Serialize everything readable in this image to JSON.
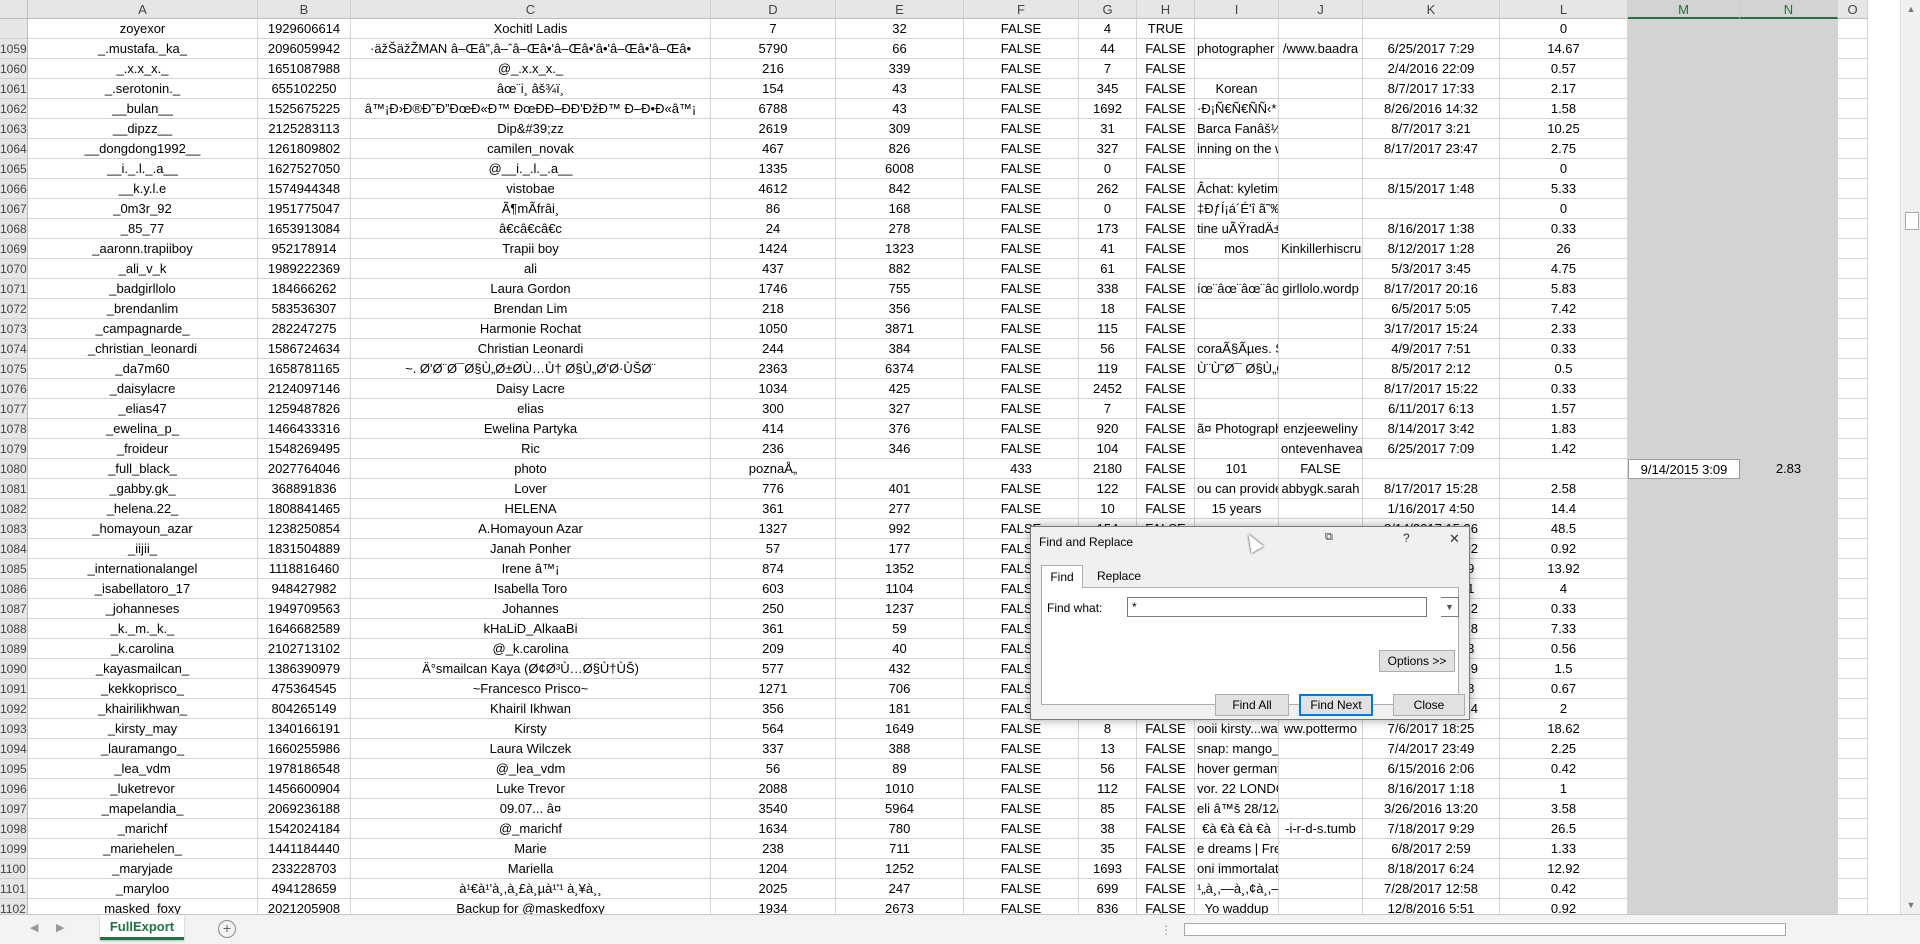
{
  "columns": [
    "",
    "A",
    "B",
    "C",
    "D",
    "E",
    "F",
    "G",
    "H",
    "I",
    "J",
    "K",
    "L",
    "M",
    "N",
    "O"
  ],
  "rows": [
    {
      "n": "",
      "c": [
        "zoyexor",
        "1929606614",
        "Xochitl Ladis",
        "7",
        "32",
        "FALSE",
        "4",
        "TRUE",
        "",
        "",
        "",
        "0",
        "",
        "",
        ""
      ]
    },
    {
      "n": "1059",
      "c": [
        "_.mustafa._ka_",
        "2096059942",
        "·äžŠäžŽMAN  â–Œâ”,â–ˆâ–Œâ•'â–Œâ•'â•'â–Œâ•'â–Œâ•",
        "5790",
        "66",
        "FALSE",
        "44",
        "FALSE",
        "photographer d",
        "/www.baadra",
        "6/25/2017 7:29",
        "14.67",
        "",
        "",
        ""
      ]
    },
    {
      "n": "1060",
      "c": [
        "_.x.x_x._",
        "1651087988",
        "@_.x.x_x._",
        "216",
        "339",
        "FALSE",
        "7",
        "FALSE",
        "",
        "",
        "2/4/2016 22:09",
        "0.57",
        "",
        "",
        ""
      ]
    },
    {
      "n": "1061",
      "c": [
        "_.serotonin._",
        "655102250",
        "âœ¨i¸ âš¾ï¸",
        "154",
        "43",
        "FALSE",
        "345",
        "FALSE",
        "Korean",
        "",
        "8/7/2017 17:33",
        "2.17",
        "",
        "",
        ""
      ]
    },
    {
      "n": "1062",
      "c": [
        "__bulan__",
        "1525675225",
        "â™¡Ð›Ð®Ð˜Ð”ÐœÐ«Ð™ ÐœÐÐ–ÐÐ'ÐžÐ™ Ð–Ð•Ð«â™¡",
        "6788",
        "43",
        "FALSE",
        "1692",
        "FALSE",
        "·Ð¡Ñ€Ñ€ÑÑ‹* *Ð¥",
        "",
        "8/26/2016 14:32",
        "1.58",
        "",
        "",
        ""
      ]
    },
    {
      "n": "1063",
      "c": [
        "__dipzz__",
        "2125283113",
        "Dip&#39;zz",
        "2619",
        "309",
        "FALSE",
        "31",
        "FALSE",
        "Barca Fanâš½ Ne",
        "",
        "8/7/2017 3:21",
        "10.25",
        "",
        "",
        ""
      ]
    },
    {
      "n": "1064",
      "c": [
        "__dongdong1992__",
        "1261809802",
        "camilen_novak",
        "467",
        "826",
        "FALSE",
        "327",
        "FALSE",
        "inning on the wi",
        "",
        "8/17/2017 23:47",
        "2.75",
        "",
        "",
        ""
      ]
    },
    {
      "n": "1065",
      "c": [
        "__i._.l._.a__",
        "1627527050",
        "@__i._.l._.a__",
        "1335",
        "6008",
        "FALSE",
        "0",
        "FALSE",
        "",
        "",
        "",
        "0",
        "",
        "",
        ""
      ]
    },
    {
      "n": "1066",
      "c": [
        "__k.y.l.e",
        "1574944348",
        "vistobae",
        "4612",
        "842",
        "FALSE",
        "262",
        "FALSE",
        "Âchat: kyletimo",
        "",
        "8/15/2017 1:48",
        "5.33",
        "",
        "",
        ""
      ]
    },
    {
      "n": "1067",
      "c": [
        "_0m3r_92",
        "1951775047",
        "Ã¶mÃfrâ­i¸",
        "86",
        "168",
        "FALSE",
        "0",
        "FALSE",
        "‡ÐƒÍ¡á´É'î ã˜‰É'",
        "",
        "",
        "0",
        "",
        "",
        ""
      ]
    },
    {
      "n": "1068",
      "c": [
        "_85_77",
        "1653913084",
        "â€câ€câ€c",
        "24",
        "278",
        "FALSE",
        "173",
        "FALSE",
        "tine uÃŸradÄ± m",
        "",
        "8/16/2017 1:38",
        "0.33",
        "",
        "",
        ""
      ]
    },
    {
      "n": "1069",
      "c": [
        "_aaronn.trapiiboy",
        "952178914",
        "Trapii boy",
        "1424",
        "1323",
        "FALSE",
        "41",
        "FALSE",
        "mos",
        "Kinkillerhiscrush.com",
        "8/12/2017 1:28",
        "26",
        "",
        "",
        ""
      ]
    },
    {
      "n": "1070",
      "c": [
        "_ali_v_k",
        "1989222369",
        "ali",
        "437",
        "882",
        "FALSE",
        "61",
        "FALSE",
        "",
        "",
        "5/3/2017 3:45",
        "4.75",
        "",
        "",
        ""
      ]
    },
    {
      "n": "1071",
      "c": [
        "_badgirllolo",
        "184666262",
        "Laura Gordon",
        "1746",
        "755",
        "FALSE",
        "338",
        "FALSE",
        "íœ¨âœ¨âœ¨âœ¨",
        "girllolo.wordp",
        "8/17/2017 20:16",
        "5.83",
        "",
        "",
        ""
      ]
    },
    {
      "n": "1072",
      "c": [
        "_brendanlim",
        "583536307",
        "Brendan Lim",
        "218",
        "356",
        "FALSE",
        "18",
        "FALSE",
        "",
        "",
        "6/5/2017 5:05",
        "7.42",
        "",
        "",
        ""
      ]
    },
    {
      "n": "1073",
      "c": [
        "_campagnarde_",
        "282247275",
        "Harmonie Rochat",
        "1050",
        "3871",
        "FALSE",
        "115",
        "FALSE",
        "",
        "",
        "3/17/2017 15:24",
        "2.33",
        "",
        "",
        ""
      ]
    },
    {
      "n": "1074",
      "c": [
        "_christian_leonardi",
        "1586724634",
        "Christian Leonardi",
        "244",
        "384",
        "FALSE",
        "56",
        "FALSE",
        "coraÃ§Ãµes. Su",
        "",
        "4/9/2017 7:51",
        "0.33",
        "",
        "",
        ""
      ]
    },
    {
      "n": "1075",
      "c": [
        "_da7m60",
        "1658781165",
        "~.      Ø'Ø¨Ø¯Ø§Ù„Ø±Ø­Ù…Ù†  Ø§Ù„Ø'Ø·ÙŠØ¨",
        "2363",
        "6374",
        "FALSE",
        "119",
        "FALSE",
        "Ù¨Ù˜Ø¯ Ø§Ù„Ø'Ù",
        "",
        "8/5/2017 2:12",
        "0.5",
        "",
        "",
        ""
      ]
    },
    {
      "n": "1076",
      "c": [
        "_daisylacre",
        "2124097146",
        "Daisy Lacre",
        "1034",
        "425",
        "FALSE",
        "2452",
        "FALSE",
        "",
        "",
        "8/17/2017 15:22",
        "0.33",
        "",
        "",
        ""
      ]
    },
    {
      "n": "1077",
      "c": [
        "_elias47",
        "1259487826",
        "elias",
        "300",
        "327",
        "FALSE",
        "7",
        "FALSE",
        "",
        "",
        "6/11/2017 6:13",
        "1.57",
        "",
        "",
        ""
      ]
    },
    {
      "n": "1078",
      "c": [
        "_ewelina_p_",
        "1466433316",
        "Ewelina Partyka",
        "414",
        "376",
        "FALSE",
        "920",
        "FALSE",
        "ã¤ Photographer",
        "enzjeeweliny",
        "8/14/2017 3:42",
        "1.83",
        "",
        "",
        ""
      ]
    },
    {
      "n": "1079",
      "c": [
        "_froideur",
        "1548269495",
        "Ric",
        "236",
        "346",
        "FALSE",
        "104",
        "FALSE",
        "",
        "ontevenhavea",
        "6/25/2017 7:09",
        "1.42",
        "",
        "",
        ""
      ]
    },
    {
      "n": "1080",
      "c": [
        "_full_black_",
        "2027764046",
        "photo",
        "poznaÅ„",
        "",
        "433",
        "2180",
        "FALSE",
        "101",
        "FALSE",
        "",
        "",
        "9/14/2015 3:09",
        "2.83",
        ""
      ]
    },
    {
      "n": "1081",
      "c": [
        "_gabby.gk_",
        "368891836",
        "Lover",
        "776",
        "401",
        "FALSE",
        "122",
        "FALSE",
        "ou can provide y",
        "abbygk.sarah",
        "8/17/2017 15:28",
        "2.58",
        "",
        "",
        ""
      ]
    },
    {
      "n": "1082",
      "c": [
        "_helena.22_",
        "1808841465",
        "HELENA",
        "361",
        "277",
        "FALSE",
        "10",
        "FALSE",
        "15 years",
        "",
        "1/16/2017 4:50",
        "14.4",
        "",
        "",
        ""
      ]
    },
    {
      "n": "1083",
      "c": [
        "_homayoun_azar",
        "1238250854",
        "A.Homayoun Azar",
        "1327",
        "992",
        "FALSE",
        "154",
        "FALSE",
        "",
        "",
        "8/14/2017 15:26",
        "48.5",
        "",
        "",
        ""
      ]
    },
    {
      "n": "1084",
      "c": [
        "_iijii_",
        "1831504889",
        "Janah Ponher",
        "57",
        "177",
        "FALSE",
        "",
        "",
        "",
        "",
        "6/17/2016 18:02",
        "0.92",
        "",
        "",
        ""
      ]
    },
    {
      "n": "1085",
      "c": [
        "_internationalangel",
        "1118816460",
        "Irene â™¡",
        "874",
        "1352",
        "FALSE",
        "",
        "",
        "",
        "",
        "8/17/2017 3:19",
        "13.92",
        "",
        "",
        ""
      ]
    },
    {
      "n": "1086",
      "c": [
        "_isabellatoro_17",
        "948427982",
        "Isabella Toro",
        "603",
        "1104",
        "FALSE",
        "",
        "",
        "",
        "",
        "8/17/2017 6:01",
        "4",
        "",
        "",
        ""
      ]
    },
    {
      "n": "1087",
      "c": [
        "_johanneses",
        "1949709563",
        "Johannes",
        "250",
        "1237",
        "FALSE",
        "",
        "",
        "",
        "",
        "8/17/2017 17:42",
        "0.33",
        "",
        "",
        ""
      ]
    },
    {
      "n": "1088",
      "c": [
        "_k._m._k._",
        "1646682589",
        "kHaLiD_AlkaaBi",
        "361",
        "59",
        "FALSE",
        "",
        "",
        "",
        "",
        "8/17/2017 18:18",
        "7.33",
        "",
        "",
        ""
      ]
    },
    {
      "n": "1089",
      "c": [
        "_k.carolina",
        "2102713102",
        "@_k.carolina",
        "209",
        "40",
        "FALSE",
        "",
        "",
        "",
        "",
        "8/17/2016 0:13",
        "0.56",
        "",
        "",
        ""
      ]
    },
    {
      "n": "1090",
      "c": [
        "_kayasmailcan_",
        "1386390979",
        "Ä°smailcan Kaya  (Ø¢Ø³Ù…Ø§Ù†ÙŠ)",
        "577",
        "432",
        "FALSE",
        "",
        "",
        "",
        "",
        "8/17/2017 23:59",
        "1.5",
        "",
        "",
        ""
      ]
    },
    {
      "n": "1091",
      "c": [
        "_kekkoprisco_",
        "475364545",
        "~Francesco Prisco~",
        "1271",
        "706",
        "FALSE",
        "",
        "",
        "",
        "",
        "8/17/2017 3:18",
        "0.67",
        "",
        "",
        ""
      ]
    },
    {
      "n": "1092",
      "c": [
        "_khairilikhwan_",
        "804265149",
        "Khairil Ikhwan",
        "356",
        "181",
        "FALSE",
        "",
        "",
        "",
        "",
        "8/17/2017 21:34",
        "2",
        "",
        "",
        ""
      ]
    },
    {
      "n": "1093",
      "c": [
        "_kirsty_may",
        "1340166191",
        "Kirsty",
        "564",
        "1649",
        "FALSE",
        "8",
        "FALSE",
        "ooii kirsty...wait",
        "ww.pottermo",
        "7/6/2017 18:25",
        "18.62",
        "",
        "",
        ""
      ]
    },
    {
      "n": "1094",
      "c": [
        "_lauramango_",
        "1660255986",
        "Laura Wilczek",
        "337",
        "388",
        "FALSE",
        "13",
        "FALSE",
        "snap: mango_l",
        "",
        "7/4/2017 23:49",
        "2.25",
        "",
        "",
        ""
      ]
    },
    {
      "n": "1095",
      "c": [
        "_lea_vdm",
        "1978186548",
        "@_lea_vdm",
        "56",
        "89",
        "FALSE",
        "56",
        "FALSE",
        "hover  germany",
        "",
        "6/15/2016 2:06",
        "0.42",
        "",
        "",
        ""
      ]
    },
    {
      "n": "1096",
      "c": [
        "_luketrevor",
        "1456600904",
        "Luke Trevor",
        "2088",
        "1010",
        "FALSE",
        "112",
        "FALSE",
        "vor. 22 LONDON",
        "",
        "8/16/2017 1:18",
        "1",
        "",
        "",
        ""
      ]
    },
    {
      "n": "1097",
      "c": [
        "_mapelandia_",
        "2069236188",
        "09.07... â¤",
        "3540",
        "5964",
        "FALSE",
        "85",
        "FALSE",
        "eli â™š 28/12/15",
        "",
        "3/26/2016 13:20",
        "3.58",
        "",
        "",
        ""
      ]
    },
    {
      "n": "1098",
      "c": [
        "_marichf",
        "1542024184",
        "@_marichf",
        "1634",
        "780",
        "FALSE",
        "38",
        "FALSE",
        "€à €à €à €à",
        "-i-r-d-s.tumb",
        "7/18/2017 9:29",
        "26.5",
        "",
        "",
        ""
      ]
    },
    {
      "n": "1099",
      "c": [
        "_mariehelen_",
        "1441184440",
        "Marie",
        "238",
        "711",
        "FALSE",
        "35",
        "FALSE",
        "e dreams | Free",
        "",
        "6/8/2017 2:59",
        "1.33",
        "",
        "",
        ""
      ]
    },
    {
      "n": "1100",
      "c": [
        "_maryjade",
        "233228703",
        "Mariella",
        "1204",
        "1252",
        "FALSE",
        "1693",
        "FALSE",
        "oni immortalate",
        "",
        "8/18/2017 6:24",
        "12.92",
        "",
        "",
        ""
      ]
    },
    {
      "n": "1101",
      "c": [
        "_maryloo",
        "494128659",
        "à¹€à¹'à¸,à¸£à¸µà¹'¹ à¸¥à¸¸",
        "2025",
        "247",
        "FALSE",
        "699",
        "FALSE",
        "¹„à¸,—à¸,¢à¸,—à¸",
        "",
        "7/28/2017 12:58",
        "0.42",
        "",
        "",
        ""
      ]
    },
    {
      "n": "1102",
      "c": [
        "masked_foxy",
        "2021205908",
        "Backup for @maskedfoxy",
        "1934",
        "2673",
        "FALSE",
        "836",
        "FALSE",
        "Yo waddup",
        "",
        "12/8/2016 5:51",
        "0.92",
        "",
        "",
        ""
      ]
    }
  ],
  "sheet_tab": "FullExport",
  "dialog": {
    "title": "Find and Replace",
    "tab_find": "Find",
    "tab_replace": "Replace",
    "find_label": "Find what:",
    "find_value": "*",
    "btn_options": "Options >>",
    "btn_find_all": "Find All",
    "btn_find_next": "Find Next",
    "btn_close": "Close",
    "help": "?",
    "close_x": "✕"
  },
  "colors": {
    "accent": "#217346",
    "selected_column": "#d3d3d3",
    "header": "#e6e6e6"
  }
}
